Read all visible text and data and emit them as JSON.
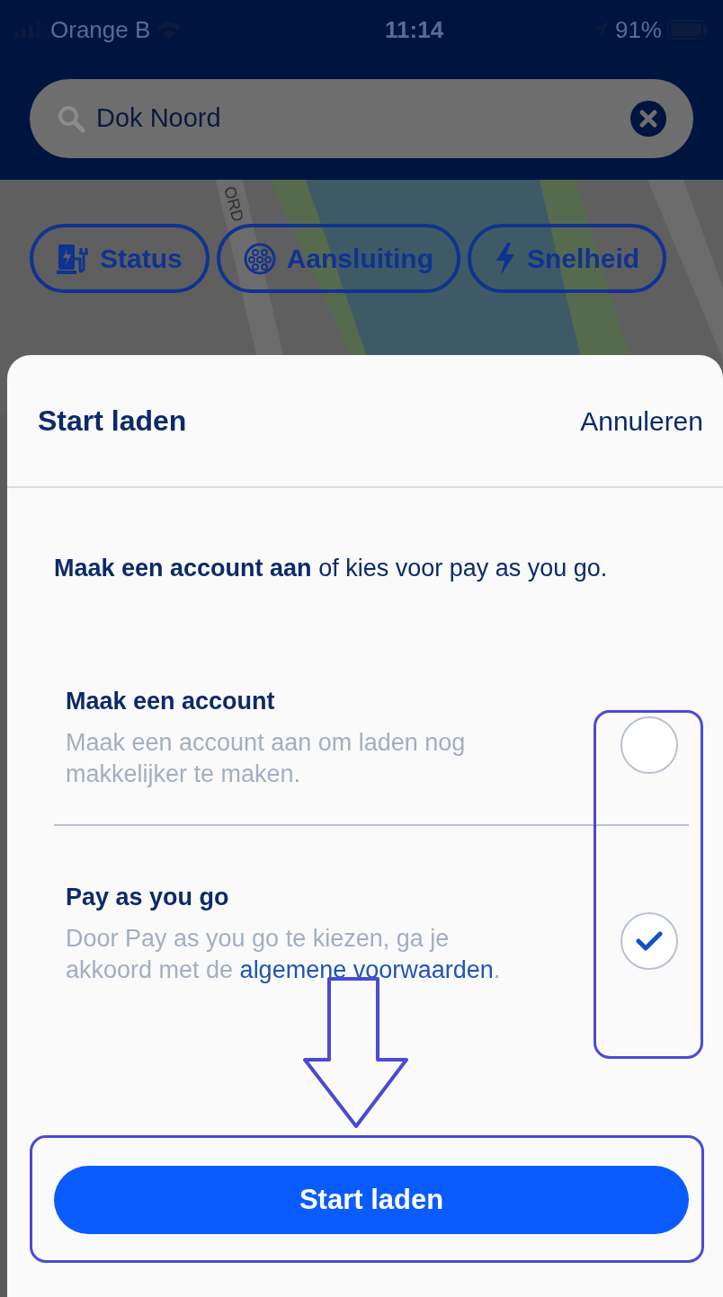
{
  "status_bar": {
    "carrier": "Orange B",
    "time": "11:14",
    "battery": "91%"
  },
  "search": {
    "value": "Dok Noord"
  },
  "map": {
    "street_label": "ORD"
  },
  "filters": [
    {
      "label": "Status",
      "kind": "status"
    },
    {
      "label": "Aansluiting",
      "kind": "connector"
    },
    {
      "label": "Snelheid",
      "kind": "speed"
    }
  ],
  "sheet": {
    "title": "Start laden",
    "cancel": "Annuleren",
    "intro": "**Maak een account aan** of kies voor pay as you go.",
    "options": [
      {
        "title": "Maak een account",
        "description": "Maak een account aan om laden nog makkelijker te maken.",
        "selected": false
      },
      {
        "title": "Pay as you go",
        "description": "Door Pay as you go te kiezen, ga je akkoord met de ",
        "link": "algemene voorwaarden",
        "after": ".",
        "selected": true
      }
    ],
    "button": "Start laden"
  }
}
